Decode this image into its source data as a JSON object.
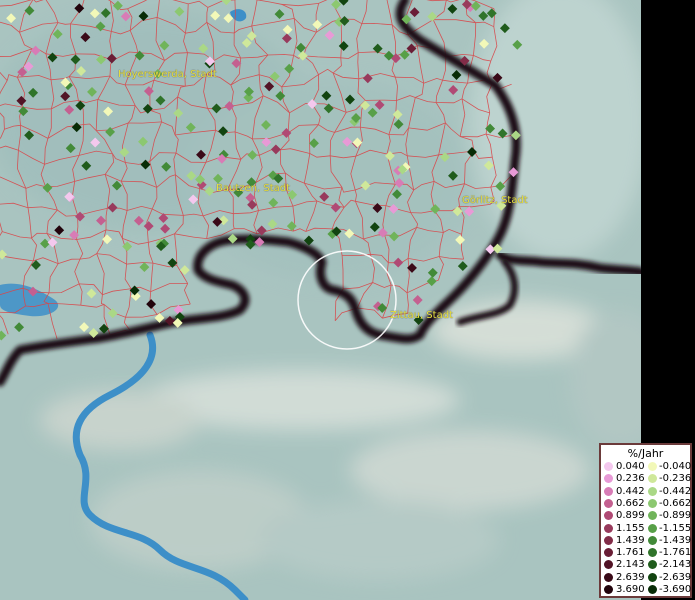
{
  "cities": [
    {
      "name": "Hoyerswerda, Stadt"
    },
    {
      "name": "Bautzen, Stadt"
    },
    {
      "name": "Görlitz, Stadt"
    },
    {
      "name": "Zittau, Stadt"
    }
  ],
  "legend": {
    "title": "%/Jahr",
    "positive": [
      {
        "label": "0.040",
        "color": "#f4c8ee"
      },
      {
        "label": "0.236",
        "color": "#e89ad6"
      },
      {
        "label": "0.442",
        "color": "#d87cb6"
      },
      {
        "label": "0.662",
        "color": "#c46090"
      },
      {
        "label": "0.899",
        "color": "#b04a74"
      },
      {
        "label": "1.155",
        "color": "#983a5c"
      },
      {
        "label": "1.439",
        "color": "#822c48"
      },
      {
        "label": "1.761",
        "color": "#6a1e36"
      },
      {
        "label": "2.143",
        "color": "#521426"
      },
      {
        "label": "2.639",
        "color": "#3a0a18"
      },
      {
        "label": "3.690",
        "color": "#22040c"
      }
    ],
    "negative": [
      {
        "label": "-0.040",
        "color": "#f2f8b8"
      },
      {
        "label": "-0.236",
        "color": "#cfe89a"
      },
      {
        "label": "-0.442",
        "color": "#aad886"
      },
      {
        "label": "-0.662",
        "color": "#8cc870"
      },
      {
        "label": "-0.899",
        "color": "#70b45a"
      },
      {
        "label": "-1.155",
        "color": "#58a048"
      },
      {
        "label": "-1.439",
        "color": "#428a38"
      },
      {
        "label": "-1.761",
        "color": "#30742a"
      },
      {
        "label": "-2.143",
        "color": "#205c1c"
      },
      {
        "label": "-2.639",
        "color": "#124410"
      },
      {
        "label": "-3.690",
        "color": "#082c06"
      }
    ]
  },
  "colors": {
    "terrain": "#a9c4c0",
    "terrain_light": "#c9d6d2",
    "district_lines": "#d8474a",
    "border": "#1a1012",
    "river": "#3d8fc8",
    "city_label": "#e8e040",
    "highlight_ring": "#ffffff"
  }
}
